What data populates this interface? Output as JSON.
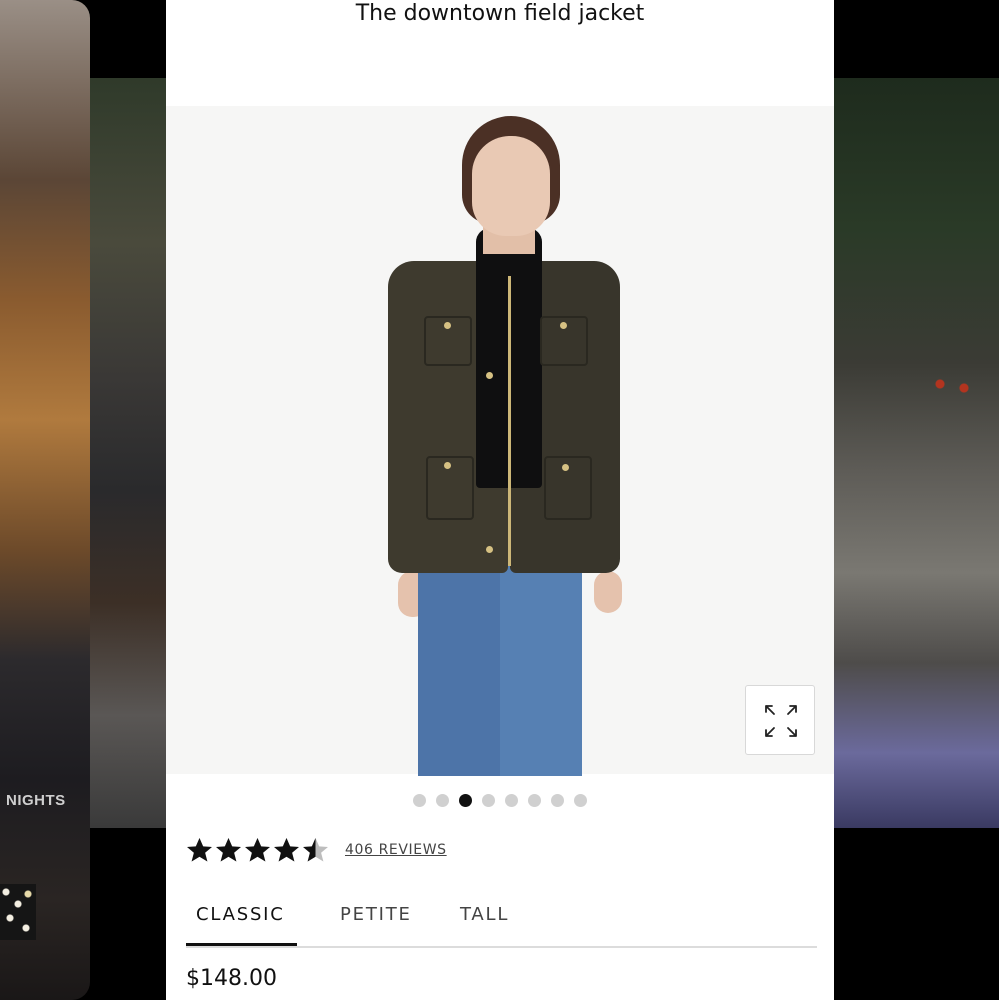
{
  "product": {
    "title": "The downtown field jacket",
    "price": "$148.00",
    "rating": 4.5,
    "reviews_label": "406 REVIEWS"
  },
  "gallery": {
    "dot_count": 8,
    "active_index": 2,
    "expand_icon": "expand-arrows-icon"
  },
  "fit_tabs": [
    {
      "label": "CLASSIC",
      "active": true
    },
    {
      "label": "PETITE",
      "active": false
    },
    {
      "label": "TALL",
      "active": false
    }
  ],
  "background": {
    "left_card_text": "NIGHTS"
  },
  "colors": {
    "text": "#111111",
    "tab_underline": "#dcdcdc",
    "dot_inactive": "#d0d0d0",
    "dot_active": "#111111"
  }
}
